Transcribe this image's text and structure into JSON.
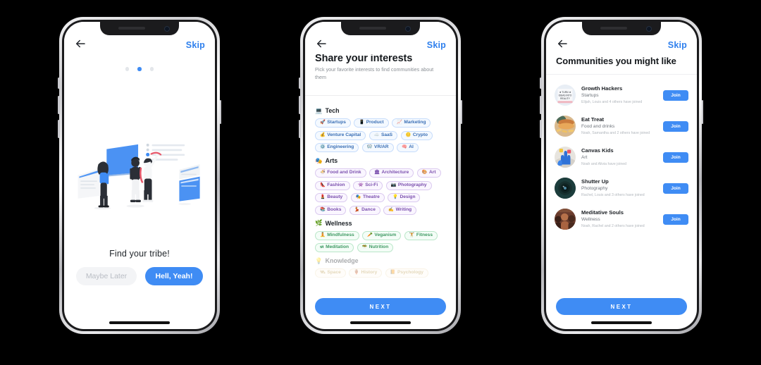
{
  "theme": {
    "accent": "#3f8cf4",
    "bg": "#000000",
    "screen_bg": "#ffffff",
    "text_dark": "#15191d",
    "text_muted": "#8b9096"
  },
  "screen1": {
    "name": "find-your-tribe",
    "back_icon": "arrow-left-icon",
    "skip_label": "Skip",
    "pagination": {
      "total": 3,
      "active_index": 1
    },
    "illustration": "people-browsing-boards-illustration",
    "tagline": "Find your tribe!",
    "secondary_button": "Maybe Later",
    "primary_button": "Hell, Yeah!"
  },
  "screen2": {
    "name": "share-your-interests",
    "back_icon": "arrow-left-icon",
    "skip_label": "Skip",
    "title": "Share your interests",
    "subtitle": "Pick your favorite interests to find communities about them",
    "next_label": "NEXT",
    "categories": [
      {
        "name": "Tech",
        "emoji": "💻",
        "style": "tech",
        "chips": [
          {
            "label": "Startups",
            "emoji": "🚀"
          },
          {
            "label": "Product",
            "emoji": "📱"
          },
          {
            "label": "Marketing",
            "emoji": "📈"
          },
          {
            "label": "Venture Capital",
            "emoji": "💰"
          },
          {
            "label": "SaaS",
            "emoji": "☁️"
          },
          {
            "label": "Crypto",
            "emoji": "🪙"
          },
          {
            "label": "Engineering",
            "emoji": "⚙️"
          },
          {
            "label": "VR/AR",
            "emoji": "🥽"
          },
          {
            "label": "AI",
            "emoji": "🧠"
          }
        ]
      },
      {
        "name": "Arts",
        "emoji": "🎭",
        "style": "arts",
        "chips": [
          {
            "label": "Food and Drink",
            "emoji": "🍜"
          },
          {
            "label": "Architecture",
            "emoji": "🏛"
          },
          {
            "label": "Art",
            "emoji": "🎨"
          },
          {
            "label": "Fashion",
            "emoji": "👠"
          },
          {
            "label": "Sci-Fi",
            "emoji": "👾"
          },
          {
            "label": "Photography",
            "emoji": "📷"
          },
          {
            "label": "Beauty",
            "emoji": "💄"
          },
          {
            "label": "Theatre",
            "emoji": "🎭"
          },
          {
            "label": "Design",
            "emoji": "💡"
          },
          {
            "label": "Books",
            "emoji": "📚"
          },
          {
            "label": "Dance",
            "emoji": "💃"
          },
          {
            "label": "Writing",
            "emoji": "✍"
          }
        ]
      },
      {
        "name": "Wellness",
        "emoji": "🌿",
        "style": "well",
        "chips": [
          {
            "label": "Mindfulness",
            "emoji": "🧘"
          },
          {
            "label": "Veganism",
            "emoji": "🥕"
          },
          {
            "label": "Fitness",
            "emoji": "🏋"
          },
          {
            "label": "Meditation",
            "emoji": "🕉"
          },
          {
            "label": "Nutrition",
            "emoji": "🥗"
          }
        ]
      },
      {
        "name": "Knowledge",
        "emoji": "💡",
        "style": "know",
        "faded": true,
        "chips": [
          {
            "label": "Space",
            "emoji": "🛰"
          },
          {
            "label": "History",
            "emoji": "🏺"
          },
          {
            "label": "Psychology",
            "emoji": "📙"
          }
        ]
      }
    ]
  },
  "screen3": {
    "name": "communities-you-might-like",
    "back_icon": "arrow-left-icon",
    "skip_label": "Skip",
    "title": "Communities you might like",
    "next_label": "NEXT",
    "join_label": "Join",
    "communities": [
      {
        "name": "Growth Hackers",
        "category": "Startups",
        "members": "Elijah, Louis and 4 others have joined",
        "avatar": "poster-turn-ideas-into-reality"
      },
      {
        "name": "Eat Treat",
        "category": "Food and drinks",
        "members": "Noah, Samantha and 2 others have joined",
        "avatar": "burger-and-fries-photo"
      },
      {
        "name": "Canvas Kids",
        "category": "Art",
        "members": "Noah and Alivia have joined",
        "avatar": "painted-hands-photo"
      },
      {
        "name": "Shutter Up",
        "category": "Photography",
        "members": "Rachel, Louis and 3 others have joined",
        "avatar": "camera-lens-photo"
      },
      {
        "name": "Meditative Souls",
        "category": "Wellness",
        "members": "Noah, Rachel and 2 others have joined",
        "avatar": "group-of-people-photo"
      }
    ]
  }
}
